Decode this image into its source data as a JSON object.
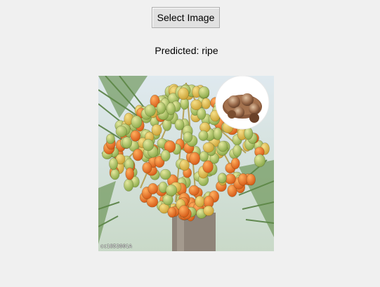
{
  "window": {
    "background_color": "#f0f0f0"
  },
  "controls": {
    "select_button_label": "Select Image"
  },
  "result": {
    "prediction_text": "Predicted: ripe"
  },
  "image": {
    "subject_icon": "areca-palm-fruit-cluster-photo",
    "inset_icon": "sliced-betel-nut-inset",
    "watermark_text": "cc1852601A"
  }
}
